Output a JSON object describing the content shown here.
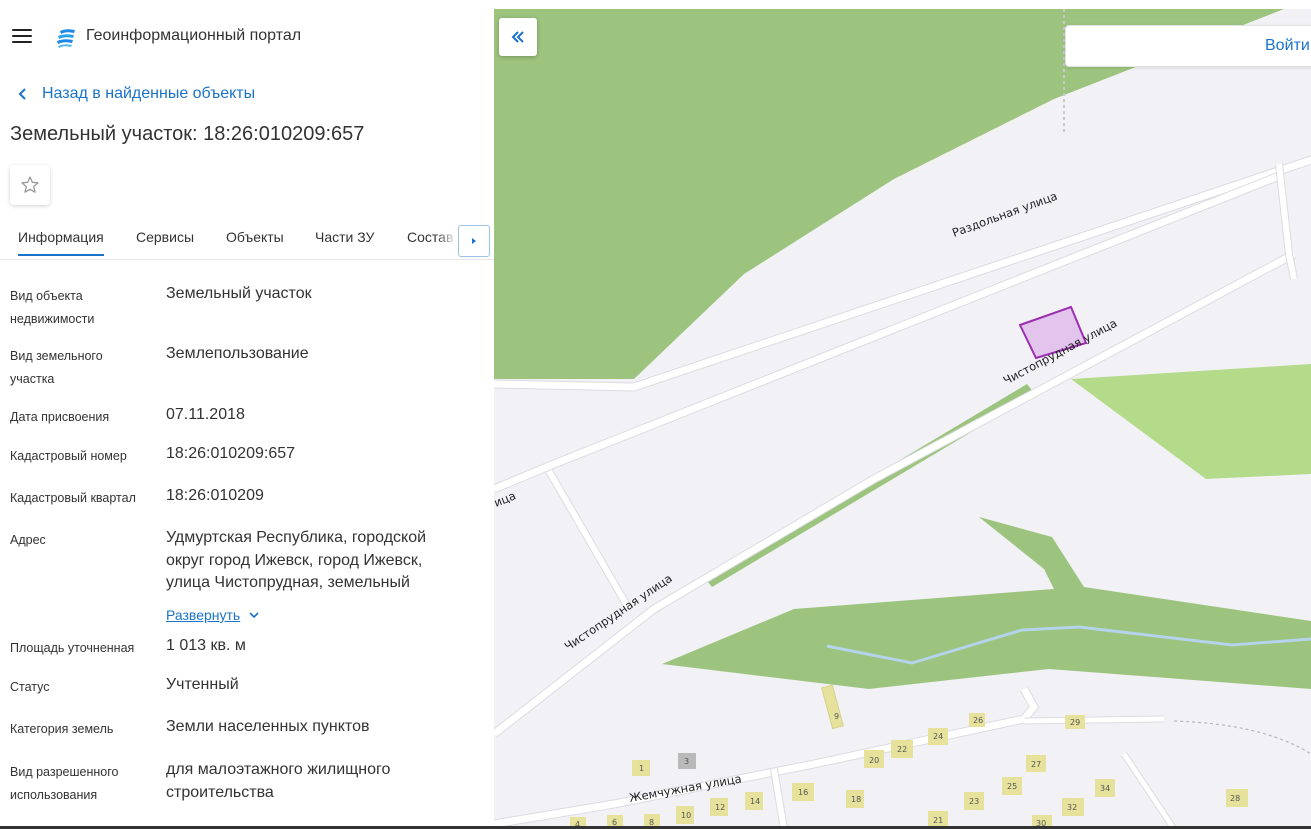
{
  "header": {
    "app_title": "Геоинформационный портал"
  },
  "navigation": {
    "back_label": "Назад в найденные объекты"
  },
  "object": {
    "title": "Земельный участок: 18:26:010209:657"
  },
  "tabs": [
    {
      "label": "Информация",
      "active": true
    },
    {
      "label": "Сервисы"
    },
    {
      "label": "Объекты"
    },
    {
      "label": "Части ЗУ"
    },
    {
      "label": "Состав"
    }
  ],
  "properties": [
    {
      "label": "Вид объекта недвижимости",
      "value": "Земельный участок"
    },
    {
      "label": "Вид земельного участка",
      "value": "Землепользование"
    },
    {
      "label": "Дата присвоения",
      "value": "07.11.2018"
    },
    {
      "label": "Кадастровый номер",
      "value": "18:26:010209:657"
    },
    {
      "label": "Кадастровый квартал",
      "value": "18:26:010209"
    },
    {
      "label": "Адрес",
      "value": "Удмуртская Республика, городской округ город Ижевск, город Ижевск, улица Чистопрудная, земельный"
    },
    {
      "label": "Площадь уточненная",
      "value": "1 013 кв. м"
    },
    {
      "label": "Статус",
      "value": "Учтенный"
    },
    {
      "label": "Категория земель",
      "value": "Земли населенных пунктов"
    },
    {
      "label": "Вид разрешенного использования",
      "value": "для малоэтажного жилищного строительства"
    }
  ],
  "address_expand_label": "Развернуть",
  "map": {
    "login_label": "Войти",
    "streets": {
      "razdolnaya": "Раздольная улица",
      "chistoprudnaya_upper": "Чистопрудная улица",
      "chistoprudnaya_lower": "Чистопрудная улица",
      "cut_label": "ица",
      "zhemchuzhnaya": "Жемчужная улица"
    },
    "house_numbers": [
      "9",
      "26",
      "29",
      "24",
      "22",
      "20",
      "27",
      "3",
      "1",
      "25",
      "34",
      "16",
      "18",
      "23",
      "32",
      "14",
      "12",
      "10",
      "28",
      "4",
      "6",
      "8",
      "21",
      "30"
    ]
  },
  "colors": {
    "accent": "#1a73c9",
    "parcel_fill": "#e2c4ec",
    "parcel_stroke": "#9b2fb0",
    "green_dark": "#9cc47e",
    "green_light": "#b3db8a"
  }
}
